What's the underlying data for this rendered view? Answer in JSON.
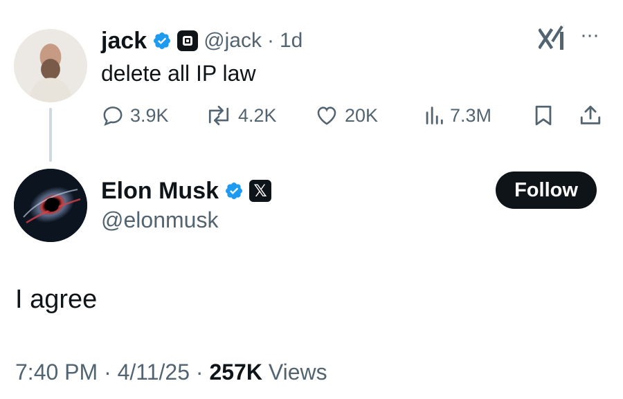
{
  "parent_tweet": {
    "display_name": "jack",
    "handle": "@jack",
    "separator": "·",
    "age": "1d",
    "text": "delete all IP law",
    "more_label": "···",
    "brand_mark": "x𝗅",
    "actions": {
      "replies": "3.9K",
      "reposts": "4.2K",
      "likes": "20K",
      "views": "7.3M"
    }
  },
  "reply_tweet": {
    "display_name": "Elon Musk",
    "handle": "@elonmusk",
    "badge_text": "𝕏",
    "follow_label": "Follow",
    "text": "I agree",
    "time": "7:40 PM",
    "sep1": " · ",
    "date": "4/11/25",
    "sep2": " · ",
    "views_count": "257K",
    "views_label": " Views"
  },
  "colors": {
    "text": "#0f1419",
    "secondary": "#536471",
    "verified": "#1d9bf0",
    "button_bg": "#0f1419",
    "thread_line": "#cfd9de"
  },
  "icons": [
    "verified-badge-icon",
    "square-badge-icon",
    "xai-logo-icon",
    "more-icon",
    "reply-icon",
    "repost-icon",
    "like-icon",
    "views-icon",
    "bookmark-icon",
    "share-icon",
    "x-logo-badge-icon"
  ]
}
